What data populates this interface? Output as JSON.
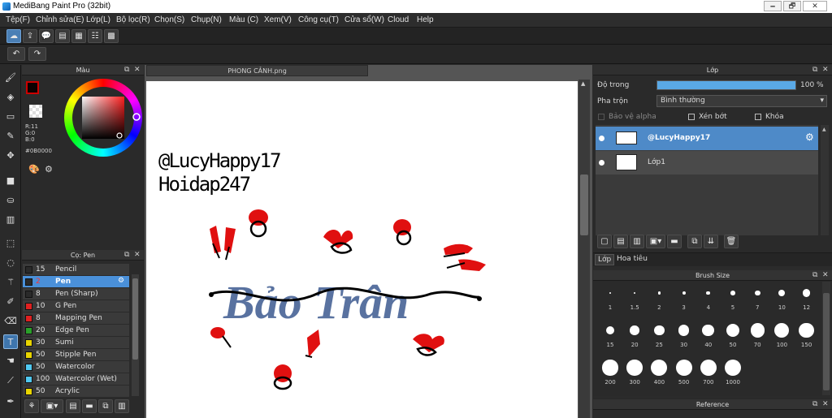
{
  "window": {
    "title": "MediBang Paint Pro (32bit)",
    "min": "🗕",
    "max": "🗗",
    "close": "✕"
  },
  "menu": [
    "Tệp(F)",
    "Chỉnh sửa(E)",
    "Lớp(L)",
    "Bộ lọc(R)",
    "Chọn(S)",
    "Chụp(N)",
    "Màu (C)",
    "Xem(V)",
    "Công cụ(T)",
    "Cửa sổ(W)",
    "Cloud",
    "Help"
  ],
  "toolbar1": {
    "icons": [
      "cloud-icon",
      "share-icon",
      "comment-icon",
      "message-icon",
      "page-icon",
      "page-settings-icon",
      "grid-icon"
    ]
  },
  "toolbar2": {
    "undo": "↶",
    "redo": "↷"
  },
  "tools": [
    "brush-icon",
    "eraser-icon",
    "rectangle-icon",
    "pen-line-icon",
    "move-icon",
    "fill-rect-icon",
    "bucket-icon",
    "gradient-icon",
    "select-rect-icon",
    "lasso-icon",
    "magic-wand-icon",
    "select-pen-icon",
    "select-eraser-icon",
    "text-icon",
    "hand-icon",
    "eyedropper-icon",
    "pen-tool-icon"
  ],
  "color_panel": {
    "title": "Màu",
    "r": "R:11",
    "g": "G:0",
    "b": "B:0",
    "hex": "#0B0000",
    "fg_color": "#0b0000",
    "accent": "#4a90d9"
  },
  "brush_panel": {
    "title": "Cọ: Pen",
    "brushes": [
      {
        "size": "15",
        "name": "Pencil",
        "color": "#2a2a2a"
      },
      {
        "size": "2",
        "name": "Pen",
        "color": "#2a2a2a",
        "selected": true
      },
      {
        "size": "8",
        "name": "Pen (Sharp)",
        "color": "#2a2a2a"
      },
      {
        "size": "10",
        "name": "G Pen",
        "color": "#e02020"
      },
      {
        "size": "8",
        "name": "Mapping Pen",
        "color": "#e02020"
      },
      {
        "size": "20",
        "name": "Edge Pen",
        "color": "#2aa02a"
      },
      {
        "size": "30",
        "name": "Sumi",
        "color": "#e8d400"
      },
      {
        "size": "50",
        "name": "Stipple Pen",
        "color": "#e8d400"
      },
      {
        "size": "50",
        "name": "Watercolor",
        "color": "#50c8f0"
      },
      {
        "size": "100",
        "name": "Watercolor (Wet)",
        "color": "#50c8f0"
      },
      {
        "size": "50",
        "name": "Acrylic",
        "color": "#e8d400"
      }
    ]
  },
  "document": {
    "tab": "PHONG CẢNH.png"
  },
  "canvas": {
    "line1": "@LucyHappy17",
    "line2": "Hoidap247",
    "art": "Bảo Trân"
  },
  "layer_panel": {
    "title": "Lớp",
    "opacity_label": "Độ trong",
    "opacity_value": "100 %",
    "opacity": 1.0,
    "blend_label": "Pha trộn",
    "blend_value": "Bình thường",
    "protect_alpha": "Bảo vệ alpha",
    "clipping": "Xén bớt",
    "lock": "Khóa",
    "layers": [
      {
        "name": "@LucyHappy17",
        "selected": true
      },
      {
        "name": "Lớp1",
        "selected": false
      }
    ],
    "tabs": [
      "Lớp",
      "Hoa tiêu"
    ]
  },
  "brush_size": {
    "title": "Brush Size",
    "sizes": [
      "1",
      "1.5",
      "2",
      "3",
      "4",
      "5",
      "7",
      "10",
      "12",
      "15",
      "20",
      "25",
      "30",
      "40",
      "50",
      "70",
      "100",
      "150",
      "200",
      "300",
      "400",
      "500",
      "700",
      "1000"
    ]
  },
  "reference": {
    "title": "Reference"
  }
}
